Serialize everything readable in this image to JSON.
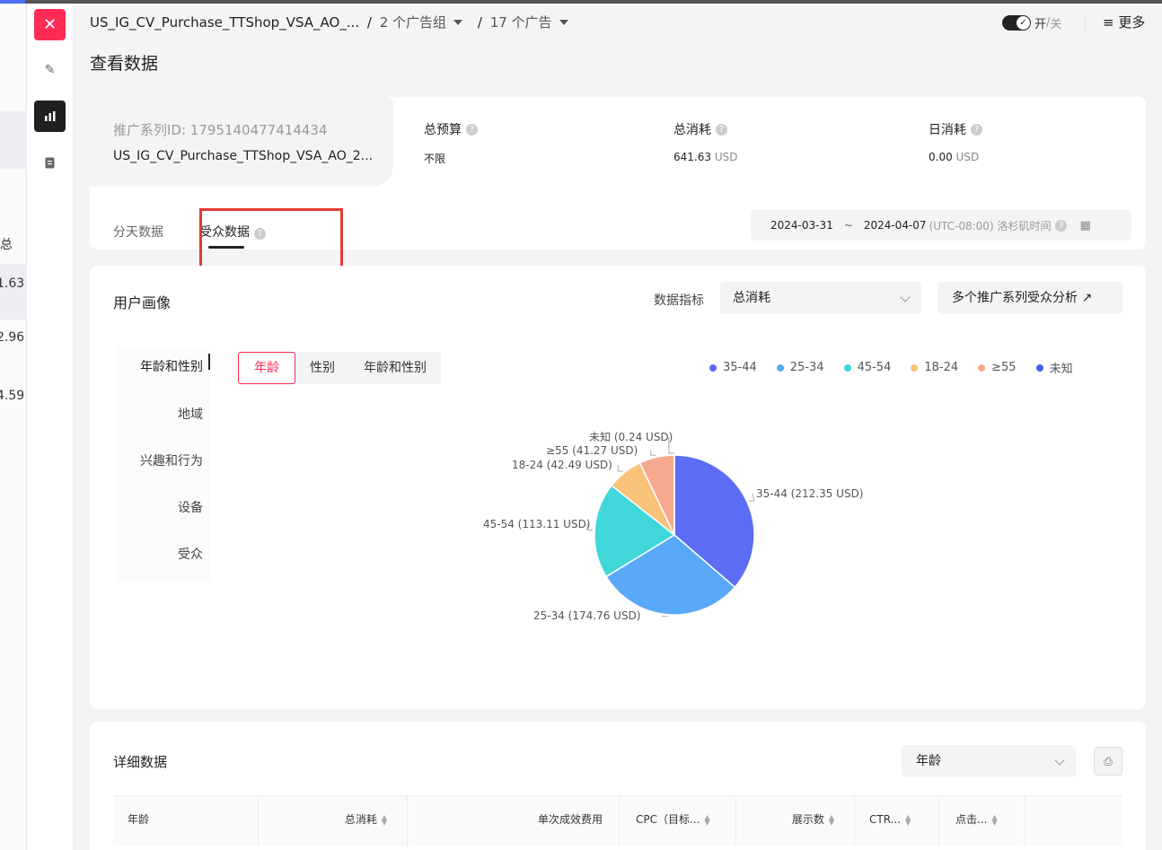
{
  "underlay": {
    "values": [
      "1.63",
      "2.96",
      "4.59"
    ],
    "header_char": "总"
  },
  "breadcrumb": {
    "campaign": "US_IG_CV_Purchase_TTShop_VSA_AO_...",
    "adgroups": "2 个广告组",
    "ads": "17 个广告"
  },
  "toggle": {
    "on": "开",
    "slash": "/",
    "off": "关"
  },
  "more_label": "更多",
  "page_title": "查看数据",
  "summary": {
    "id_label": "推广系列ID: 1795140477414434",
    "campaign_name": "US_IG_CV_Purchase_TTShop_VSA_AO_2...",
    "total_budget_label": "总预算",
    "total_budget_value": "不限",
    "total_cost_label": "总消耗",
    "total_cost_value": "641.63",
    "daily_cost_label": "日消耗",
    "daily_cost_value": "0.00",
    "unit": "USD"
  },
  "tabs": {
    "daily": "分天数据",
    "audience": "受众数据"
  },
  "date_range": {
    "start": "2024-03-31",
    "tilde": "~",
    "end": "2024-04-07",
    "tz": "(UTC-08:00) 洛杉矶时间"
  },
  "portrait": {
    "title": "用户画像",
    "metric_label": "数据指标",
    "metric_value": "总消耗",
    "multi_button": "多个推广系列受众分析",
    "sidenav": [
      "年龄和性别",
      "地域",
      "兴趣和行为",
      "设备",
      "受众"
    ],
    "segments": [
      "年龄",
      "性别",
      "年龄和性别"
    ]
  },
  "chart_data": {
    "type": "pie",
    "unit": "USD",
    "categories": [
      "35-44",
      "25-34",
      "45-54",
      "18-24",
      "≥55",
      "未知"
    ],
    "values": [
      212.35,
      174.76,
      113.11,
      42.49,
      41.27,
      0.24
    ],
    "labels": [
      "35-44 (212.35 USD)",
      "25-34 (174.76 USD)",
      "45-54 (113.11 USD)",
      "18-24 (42.49 USD)",
      "≥55 (41.27 USD)",
      "未知 (0.24 USD)"
    ],
    "colors": [
      "#5b6ef5",
      "#5aa8f8",
      "#3fd7d9",
      "#f8c27a",
      "#f6a98e",
      "#4b5ee8"
    ],
    "legend_position": "top-right"
  },
  "detail": {
    "title": "详细数据",
    "dimension": "年龄",
    "export_icon": "export-icon",
    "columns": [
      "年龄",
      "总消耗",
      "单次成效费用",
      "CPC（目标...",
      "展示数",
      "CTR...",
      "点击..."
    ]
  },
  "help": "?"
}
